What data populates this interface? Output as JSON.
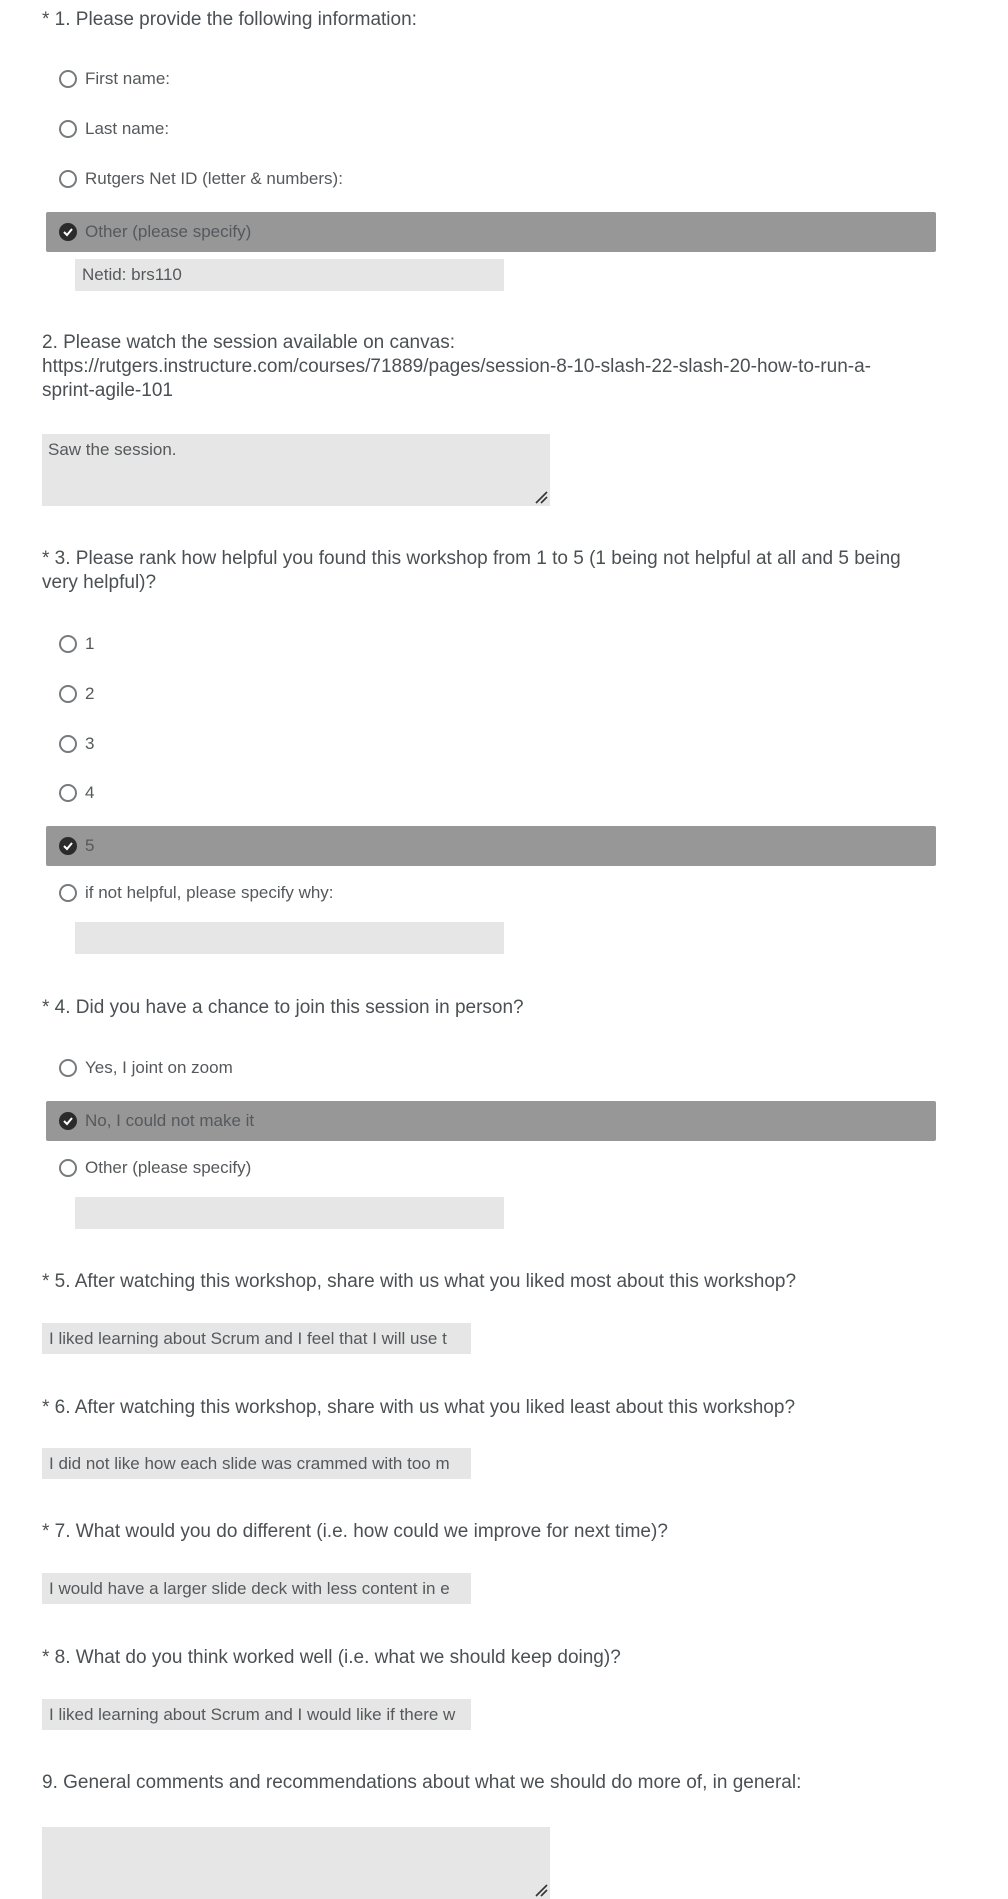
{
  "q1": {
    "title": "* 1. Please provide the following information:",
    "options": [
      "First name:",
      "Last name:",
      "Rutgers Net ID (letter & numbers):",
      "Other (please specify)"
    ],
    "selected_index": 3,
    "other_value": "Netid: brs110"
  },
  "q2": {
    "title_line1": "2. Please watch the session available on canvas:",
    "title_line2": "https://rutgers.instructure.com/courses/71889/pages/session-8-10-slash-22-slash-20-how-to-run-a-",
    "title_line3": "sprint-agile-101",
    "answer": "Saw the session."
  },
  "q3": {
    "title_line1": "* 3. Please rank how  helpful you found this workshop from 1 to 5 (1 being not helpful at all and 5 being",
    "title_line2": "very helpful)?",
    "options": [
      "1",
      "2",
      "3",
      "4",
      "5",
      "if not helpful,  please specify why:"
    ],
    "selected_index": 4,
    "other_value": ""
  },
  "q4": {
    "title": "* 4. Did you have a chance to join this session in person?",
    "options": [
      "Yes, I joint on zoom",
      "No, I could not make it",
      "Other (please specify)"
    ],
    "selected_index": 1,
    "other_value": ""
  },
  "q5": {
    "title": "* 5. After watching this workshop, share with us what you liked most about this workshop?",
    "answer": "I liked learning about Scrum and I feel that I will use t"
  },
  "q6": {
    "title": "* 6. After watching this workshop, share with us what you liked least about this workshop?",
    "answer": "I did not like how each slide was crammed with too m"
  },
  "q7": {
    "title": "* 7. What would you do different (i.e. how could we improve for next time)?",
    "answer": "I would have a larger slide deck with less content in e"
  },
  "q8": {
    "title": "* 8. What do you think worked well (i.e. what we should keep doing)?",
    "answer": "I liked learning about Scrum and I would like if there w"
  },
  "q9": {
    "title": "9. General comments and recommendations  about what we should do more of, in general:",
    "answer": ""
  }
}
